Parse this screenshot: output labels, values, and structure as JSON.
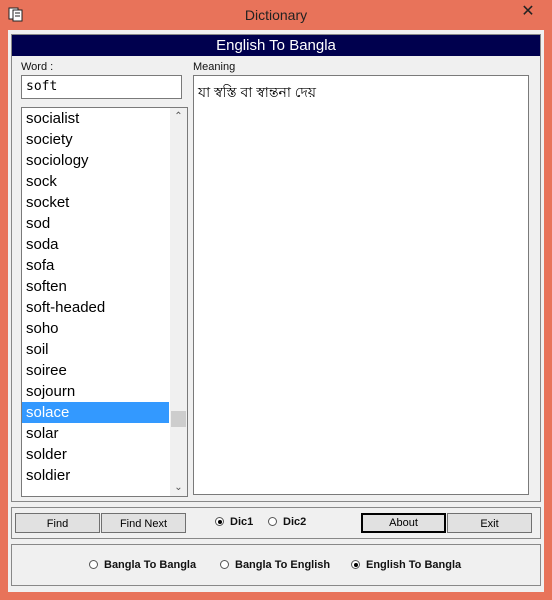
{
  "window": {
    "title": "Dictionary",
    "close_glyph": "✕"
  },
  "banner": {
    "text": "English To Bangla"
  },
  "word": {
    "label": "Word :",
    "value": "soft"
  },
  "meaning": {
    "label": "Meaning",
    "text": "যা স্বস্তি বা স্বান্তনা দেয়"
  },
  "word_list": {
    "items": [
      "socialist",
      "society",
      "sociology",
      "sock",
      "socket",
      "sod",
      "soda",
      "sofa",
      "soften",
      "soft-headed",
      "soho",
      "soil",
      "soiree",
      "sojourn",
      "solace",
      "solar",
      "solder",
      "soldier"
    ],
    "selected": "solace"
  },
  "toolbar": {
    "find_label": "Find",
    "find_next_label": "Find Next",
    "dic1_label": "Dic1",
    "dic2_label": "Dic2",
    "dic_selected": "Dic1",
    "about_label": "About",
    "exit_label": "Exit"
  },
  "mode": {
    "options": [
      "Bangla To Bangla",
      "Bangla To English",
      "English To Bangla"
    ],
    "selected": "English To Bangla"
  },
  "colors": {
    "banner_bg": "#00004e",
    "selection": "#3399ff",
    "frame": "#e8735a"
  }
}
